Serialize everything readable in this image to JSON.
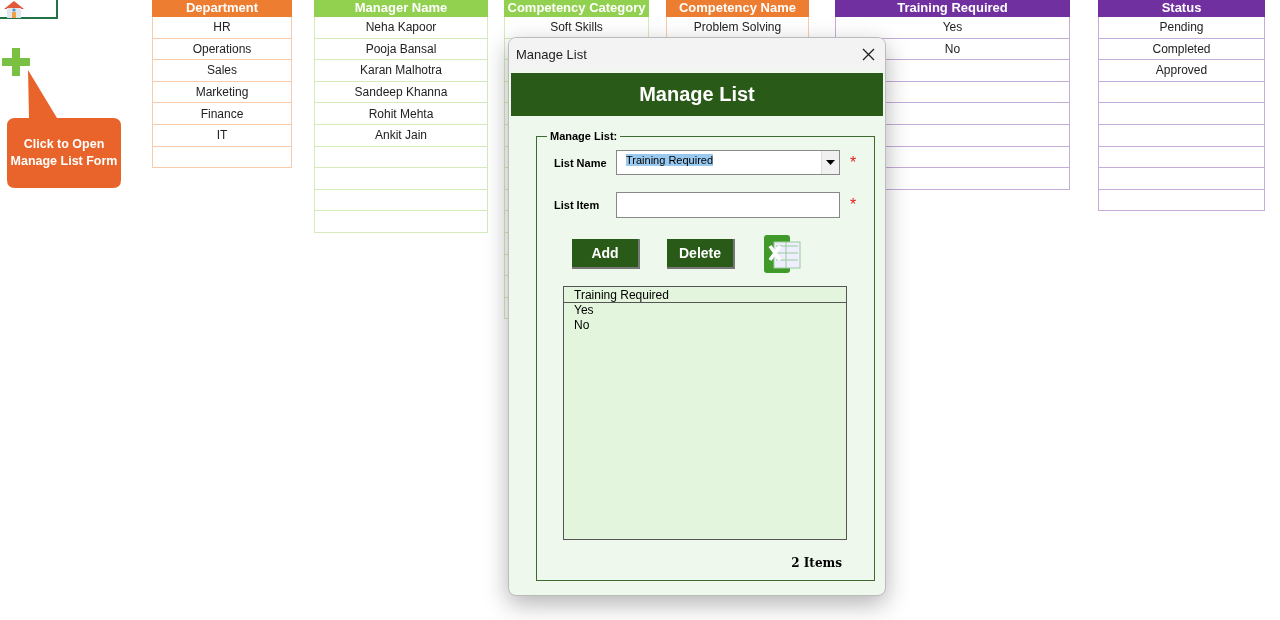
{
  "sheet": {
    "callout": "Click to Open Manage List Form",
    "tables": [
      {
        "header": "Department",
        "color": "#ed7d31",
        "rows": [
          "HR",
          "Operations",
          "Sales",
          "Marketing",
          "Finance",
          "IT"
        ]
      },
      {
        "header": "Manager Name",
        "color": "#92d050",
        "rows": [
          "Neha Kapoor",
          "Pooja Bansal",
          "Karan Malhotra",
          "Sandeep Khanna",
          "Rohit Mehta",
          "Ankit Jain"
        ]
      },
      {
        "header": "Competency Category",
        "color": "#92d050",
        "rows": [
          "Soft Skills"
        ]
      },
      {
        "header": "Competency Name",
        "color": "#ed7d31",
        "rows": [
          "Problem Solving"
        ]
      },
      {
        "header": "Training Required",
        "color": "#7030a0",
        "rows": [
          "Yes",
          "No"
        ]
      },
      {
        "header": "Status",
        "color": "#7030a0",
        "rows": [
          "Pending",
          "Completed",
          "Approved"
        ]
      }
    ]
  },
  "dialog": {
    "title": "Manage List",
    "banner": "Manage List",
    "group_label": "Manage List:",
    "fields": [
      {
        "kind": "combo",
        "label": "List Name",
        "value": "Training Required",
        "required_mark": "*"
      },
      {
        "kind": "text",
        "label": "List Item",
        "required_mark": "*"
      }
    ],
    "buttons": [
      "Add",
      "Delete"
    ],
    "listbox": {
      "header": "Training Required",
      "items": [
        "Yes",
        "No"
      ]
    },
    "count": "2 Items"
  }
}
